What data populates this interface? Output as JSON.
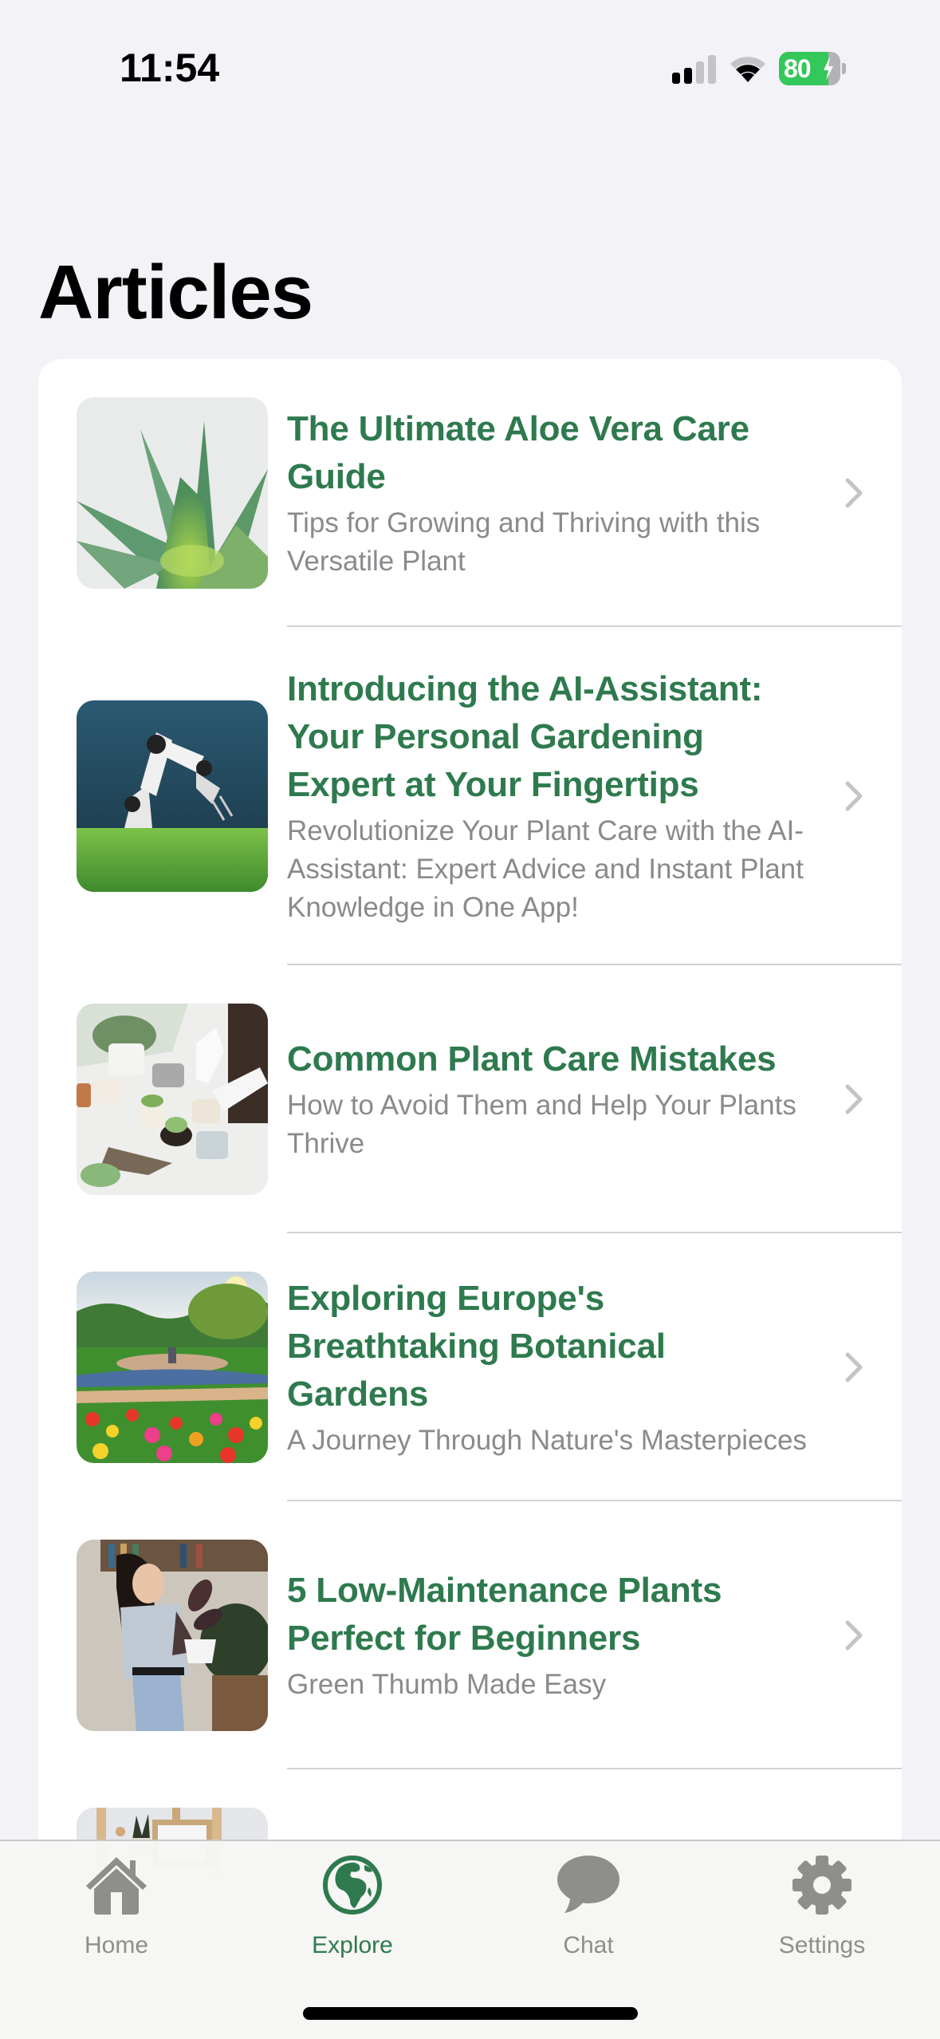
{
  "status_bar": {
    "time": "11:54",
    "battery_percent": 80,
    "battery_label": "80",
    "charging": true,
    "signal_bars_active": 2,
    "signal_bars_total": 4
  },
  "page": {
    "title": "Articles"
  },
  "articles": [
    {
      "title": "The Ultimate Aloe Vera Care Guide",
      "subtitle": "Tips for Growing and Thriving with this Versatile Plant",
      "image": "aloe-vera-photo"
    },
    {
      "title": "Introducing the AI-Assistant: Your Personal Gardening Expert at Your Fingertips",
      "subtitle": "Revolutionize Your Plant Care with the AI-Assistant: Expert Advice and Instant Plant Knowledge in One App!",
      "image": "robot-arm-photo"
    },
    {
      "title": "Common Plant Care Mistakes",
      "subtitle": "How to Avoid Them and Help Your Plants Thrive",
      "image": "potting-succulents-photo"
    },
    {
      "title": "Exploring Europe's Breathtaking Botanical Gardens",
      "subtitle": "A Journey Through Nature's Masterpieces",
      "image": "botanical-garden-photo"
    },
    {
      "title": "5 Low-Maintenance Plants Perfect for Beginners",
      "subtitle": "Green Thumb Made Easy",
      "image": "woman-with-plant-photo"
    },
    {
      "title": "",
      "subtitle": "",
      "image": "shelf-with-plant-photo"
    }
  ],
  "tab_bar": {
    "tabs": [
      {
        "label": "Home",
        "icon": "house-icon",
        "active": false
      },
      {
        "label": "Explore",
        "icon": "globe-icon",
        "active": true
      },
      {
        "label": "Chat",
        "icon": "chat-bubble-icon",
        "active": false
      },
      {
        "label": "Settings",
        "icon": "gear-icon",
        "active": false
      }
    ]
  },
  "colors": {
    "accent": "#2e7a4e",
    "background": "#f2f2f7",
    "subtitle": "#8a8a8e",
    "inactive_tab": "#8e8e8c",
    "battery": "#34c759"
  }
}
